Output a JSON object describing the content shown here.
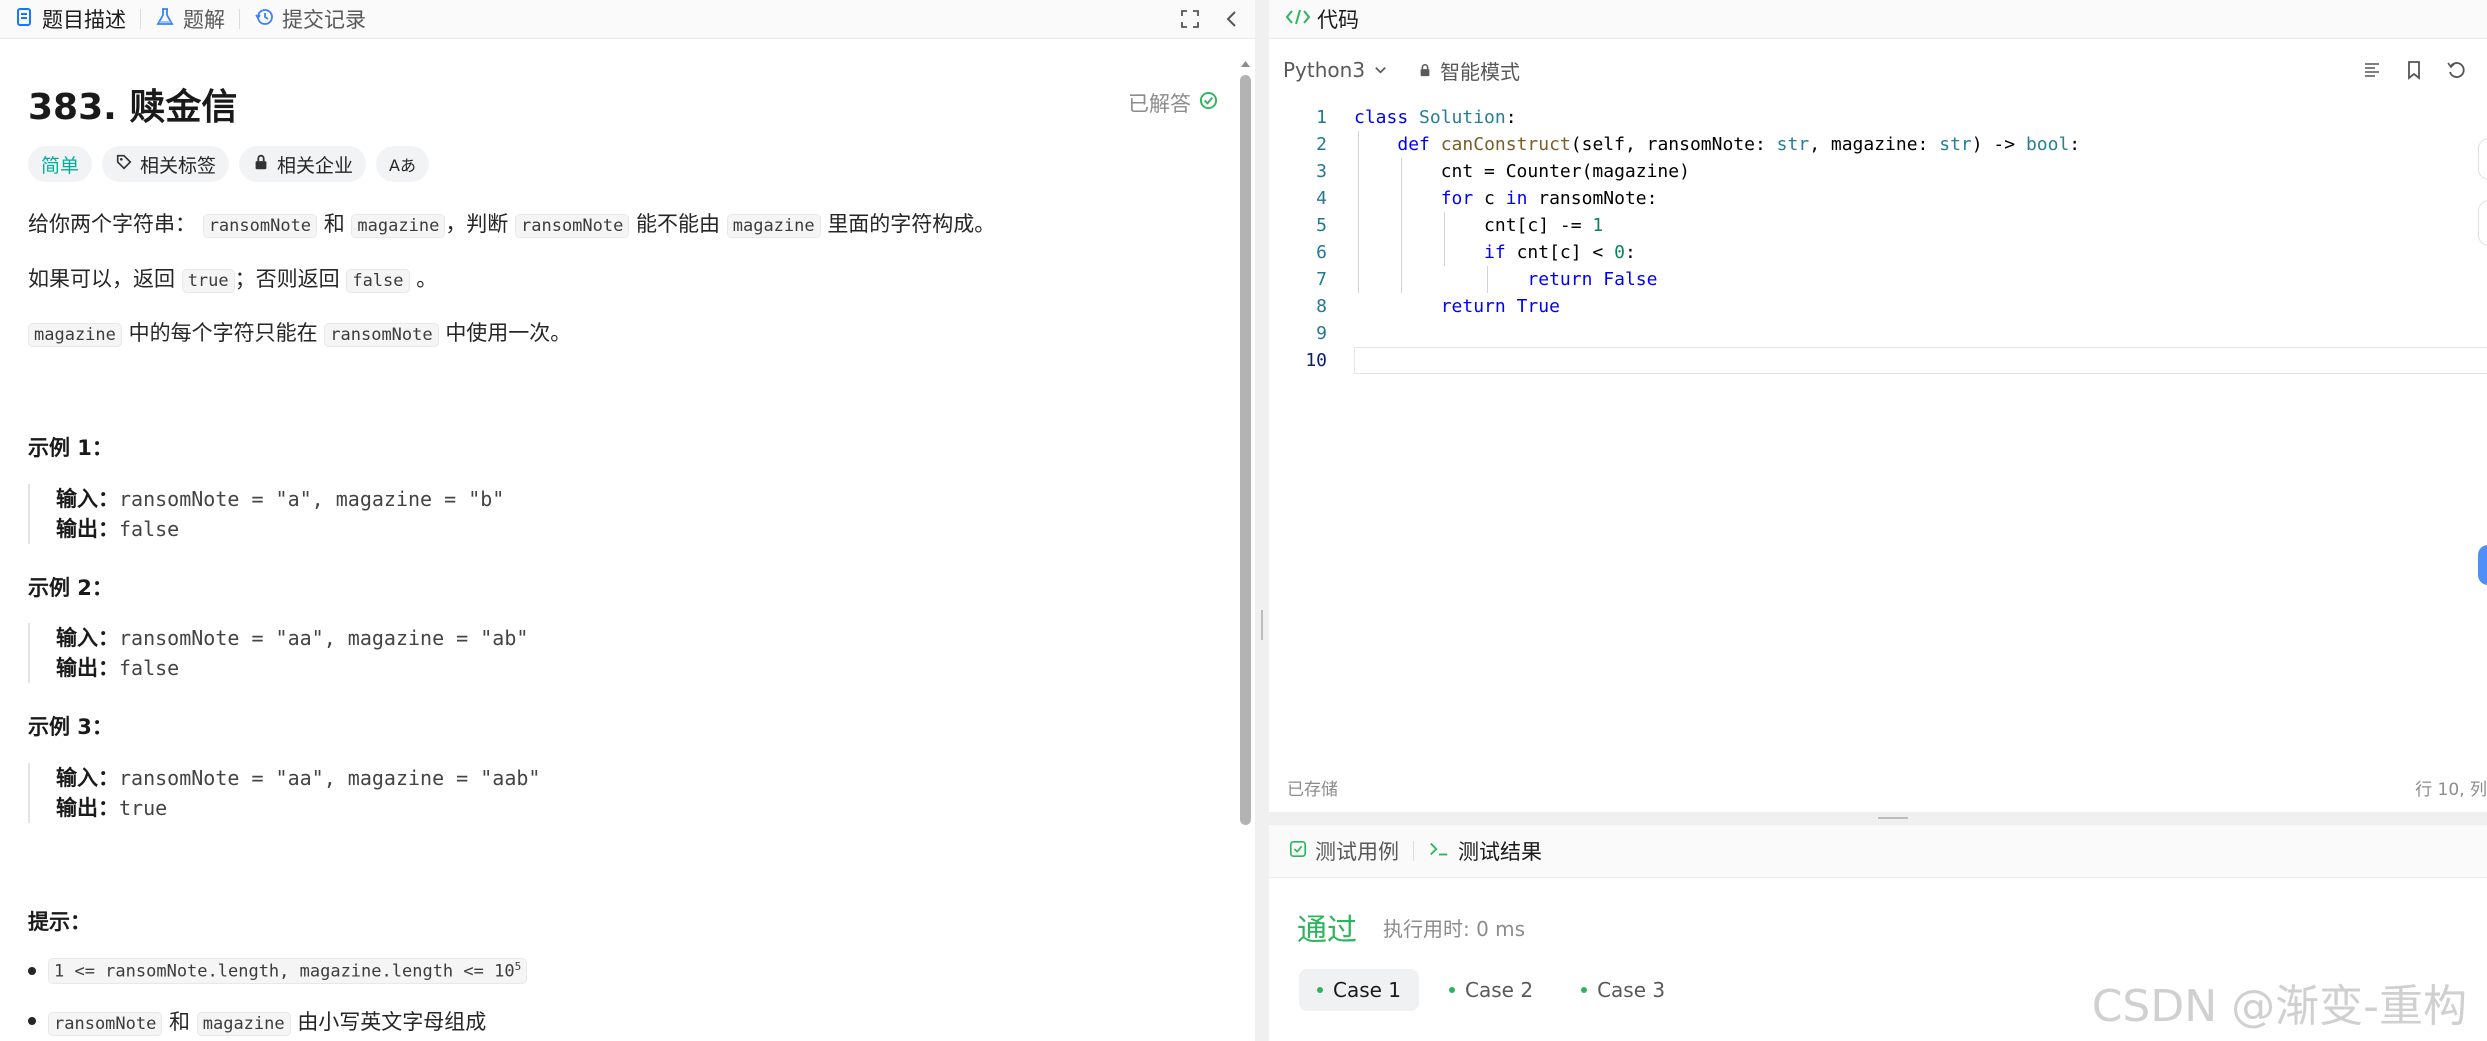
{
  "left_tabs": [
    {
      "label": "题目描述",
      "icon": "document-icon"
    },
    {
      "label": "题解",
      "icon": "flask-icon"
    },
    {
      "label": "提交记录",
      "icon": "history-icon"
    }
  ],
  "problem": {
    "title": "383. 赎金信",
    "status": "已解答",
    "tags": [
      "简单",
      "相关标签",
      "相关企业",
      "Aあ"
    ],
    "desc1": {
      "a": "给你两个字符串：",
      "code1": "ransomNote",
      "b": "和",
      "code2": "magazine",
      "c": "，判断",
      "code3": "ransomNote",
      "d": "能不能由",
      "code4": "magazine",
      "e": "里面的字符构成。"
    },
    "desc2": {
      "a": "如果可以，返回",
      "code1": "true",
      "b": "；否则返回",
      "code2": "false",
      "c": "。"
    },
    "desc3": {
      "code1": "magazine",
      "a": "中的每个字符只能在",
      "code2": "ransomNote",
      "b": "中使用一次。"
    },
    "examples": [
      {
        "title": "示例 1：",
        "input_label": "输入：",
        "input": "ransomNote = \"a\", magazine = \"b\"",
        "output_label": "输出：",
        "output": "false"
      },
      {
        "title": "示例 2：",
        "input_label": "输入：",
        "input": "ransomNote = \"aa\", magazine = \"ab\"",
        "output_label": "输出：",
        "output": "false"
      },
      {
        "title": "示例 3：",
        "input_label": "输入：",
        "input": "ransomNote = \"aa\", magazine = \"aab\"",
        "output_label": "输出：",
        "output": "true"
      }
    ],
    "hints_title": "提示：",
    "hint1": {
      "code": "1 <= ransomNote.length, magazine.length <= 10",
      "sup": "5"
    },
    "hint2": {
      "code1": "ransomNote",
      "a": "和",
      "code2": "magazine",
      "b": "由小写英文字母组成"
    }
  },
  "code": {
    "header": "代码",
    "language": "Python3",
    "mode": "智能模式",
    "saved": "已存储",
    "cursor": "行 10, 列",
    "line_numbers": [
      "1",
      "2",
      "3",
      "4",
      "5",
      "6",
      "7",
      "8",
      "9",
      "10"
    ]
  },
  "tests": {
    "tabs": [
      "测试用例",
      "测试结果"
    ],
    "status": "通过",
    "runtime": "执行用时: 0 ms",
    "cases": [
      "Case 1",
      "Case 2",
      "Case 3"
    ]
  },
  "watermark": "CSDN @渐变-重构"
}
